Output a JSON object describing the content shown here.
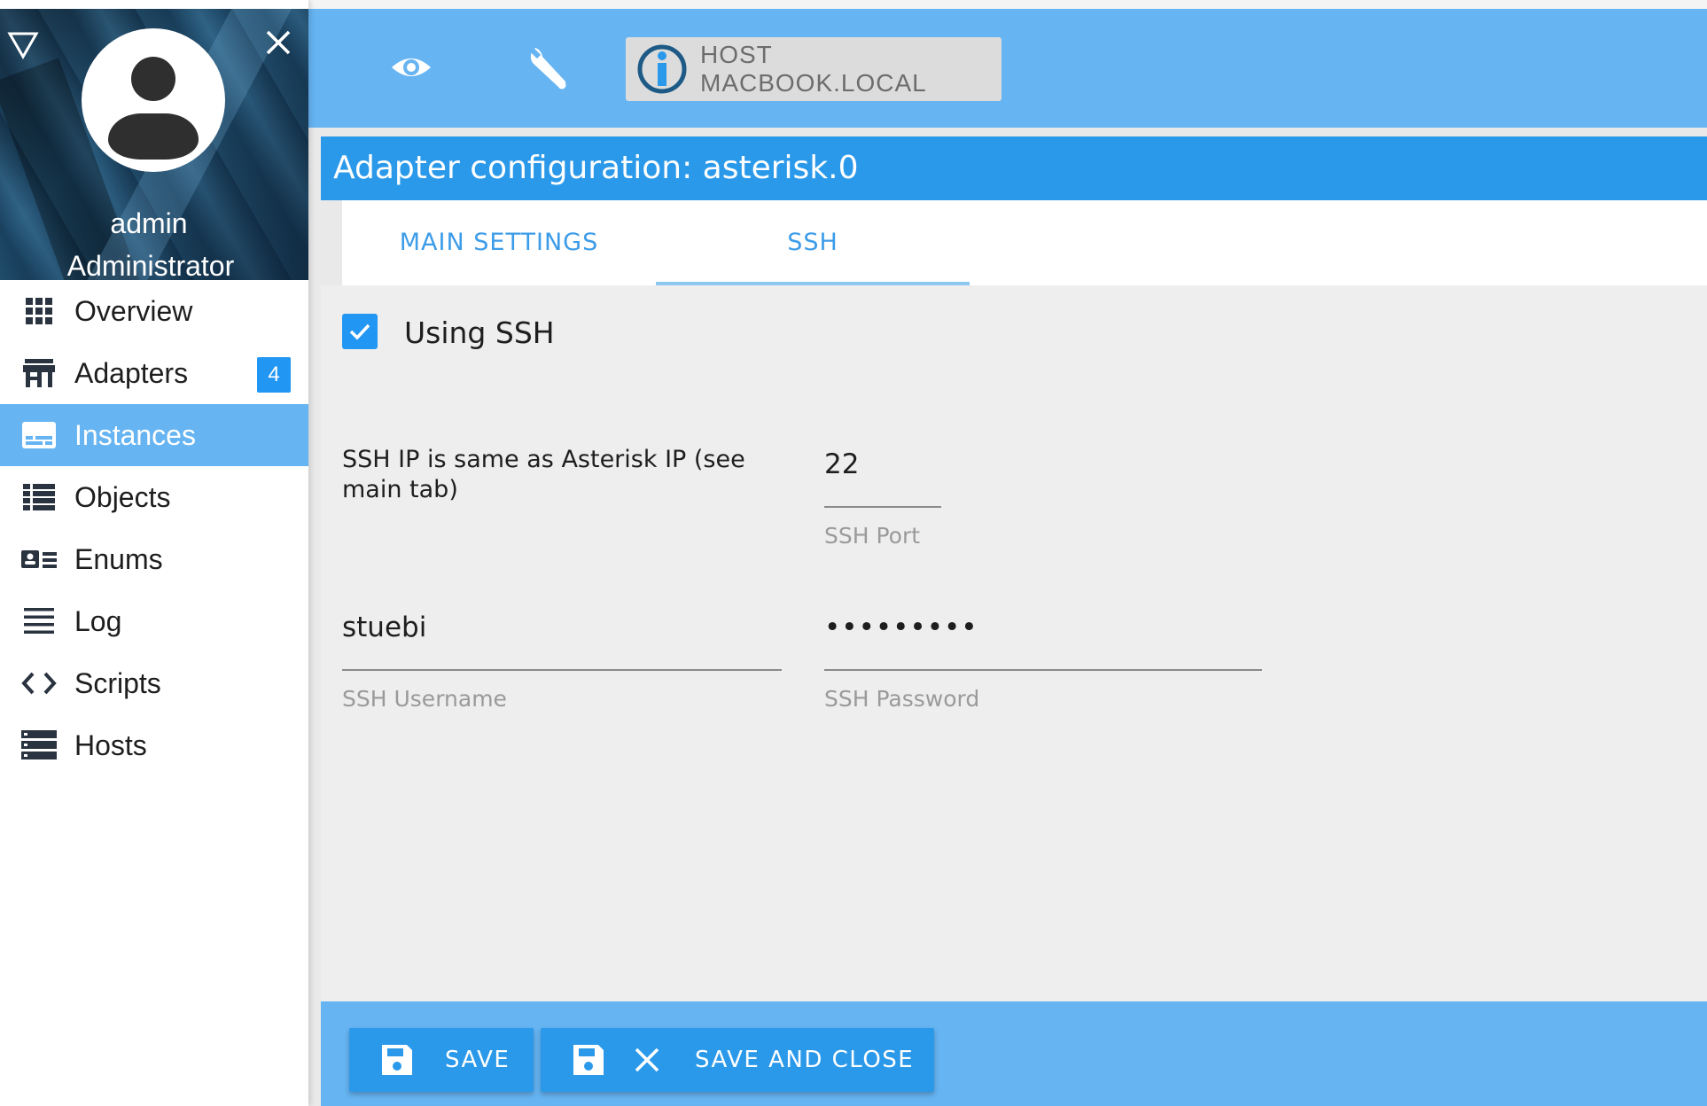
{
  "user": {
    "name": "admin",
    "role": "Administrator"
  },
  "nav": {
    "items": [
      {
        "label": "Overview",
        "icon": "apps-grid-icon"
      },
      {
        "label": "Adapters",
        "icon": "store-icon",
        "badge": "4"
      },
      {
        "label": "Instances",
        "icon": "subtitles-icon",
        "active": true
      },
      {
        "label": "Objects",
        "icon": "list-icon"
      },
      {
        "label": "Enums",
        "icon": "contact-list-icon"
      },
      {
        "label": "Log",
        "icon": "lines-icon"
      },
      {
        "label": "Scripts",
        "icon": "code-icon"
      },
      {
        "label": "Hosts",
        "icon": "storage-icon"
      }
    ]
  },
  "topbar": {
    "host_label": "HOST MACBOOK.LOCAL"
  },
  "dialog": {
    "title": "Adapter configuration: asterisk.0",
    "tabs": [
      {
        "label": "MAIN SETTINGS"
      },
      {
        "label": "SSH",
        "active": true
      }
    ]
  },
  "ssh": {
    "using_ssh_label": "Using SSH",
    "using_ssh_checked": true,
    "ip_note": "SSH IP is same as Asterisk IP (see main tab)",
    "port": {
      "value": "22",
      "label": "SSH Port"
    },
    "username": {
      "value": "stuebi",
      "label": "SSH Username"
    },
    "password": {
      "value": "•••••••••",
      "label": "SSH Password"
    }
  },
  "footer": {
    "save_label": "SAVE",
    "save_close_label": "SAVE AND CLOSE"
  },
  "colors": {
    "primary": "#2b99ea",
    "bar": "#66b4f2",
    "accent": "#2196f3"
  }
}
